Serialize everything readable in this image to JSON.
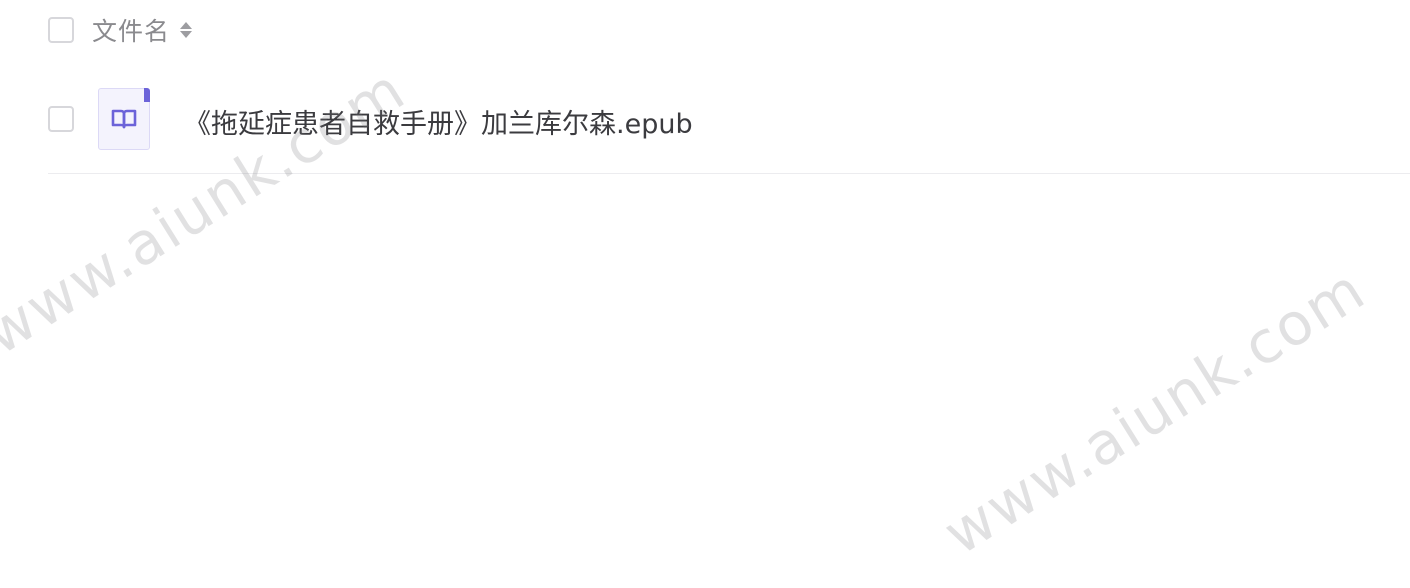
{
  "header": {
    "column_title": "文件名",
    "sort_icon": "sort-updown-icon"
  },
  "files": [
    {
      "name": "《拖延症患者自救手册》加兰库尔森.epub",
      "icon": "book-icon",
      "icon_color": "#6c63d9"
    }
  ],
  "watermarks": [
    "www.aiunk.com",
    "www.aiunk.com"
  ],
  "colors": {
    "accent": "#6c63d9",
    "text": "#3b3b3f",
    "muted": "#8a8a8e"
  }
}
